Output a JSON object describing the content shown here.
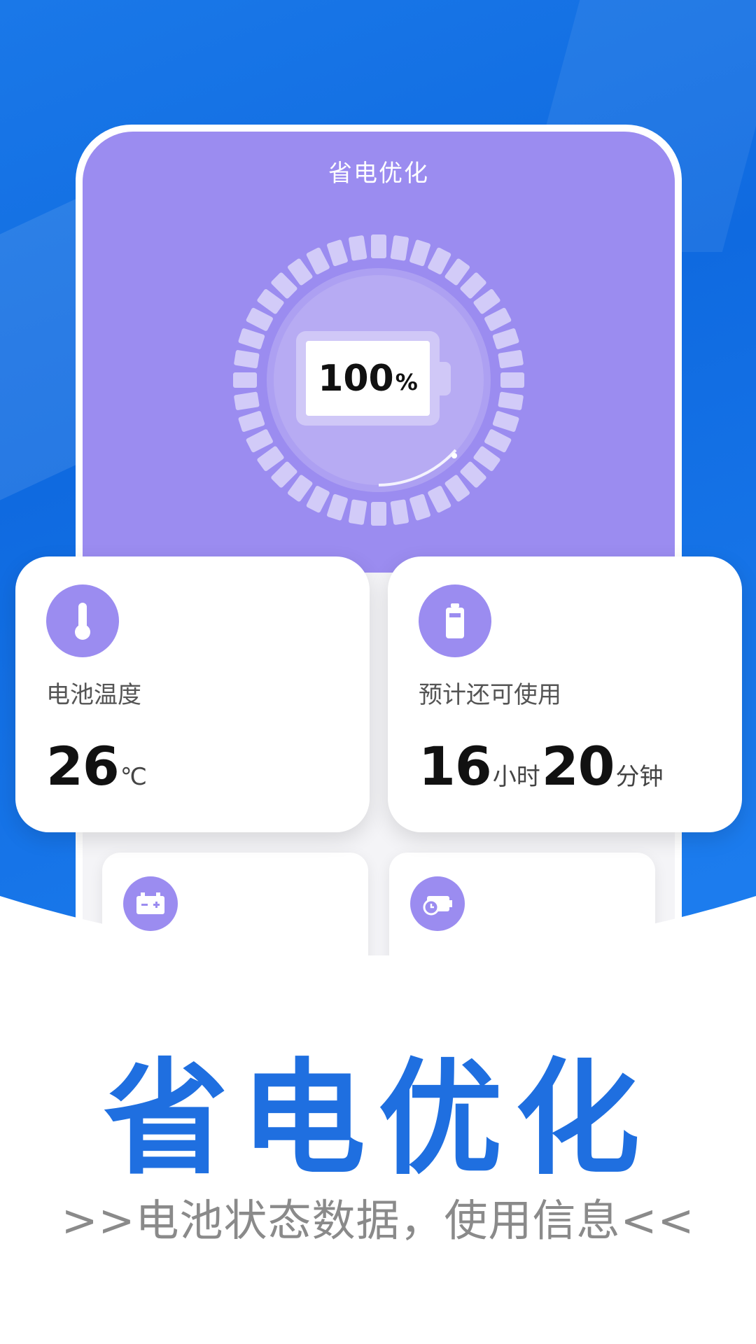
{
  "app": {
    "title": "省电优化"
  },
  "battery": {
    "level": "100",
    "percent_sign": "%"
  },
  "stats": {
    "temperature": {
      "label": "电池温度",
      "value": "26",
      "unit": "℃"
    },
    "remaining": {
      "label": "预计还可使用",
      "hours": "16",
      "hours_unit": "小时",
      "minutes": "20",
      "minutes_unit": "分钟"
    }
  },
  "banner": {
    "headline": "省电优化",
    "subline": ">>电池状态数据，使用信息<<"
  },
  "colors": {
    "background_blue": "#1a78e8",
    "accent_purple": "#9b8cf0",
    "headline_blue": "#1f6fe0"
  },
  "icons": [
    "thermometer-icon",
    "battery-icon",
    "battery-charge-icon",
    "battery-clock-icon"
  ]
}
